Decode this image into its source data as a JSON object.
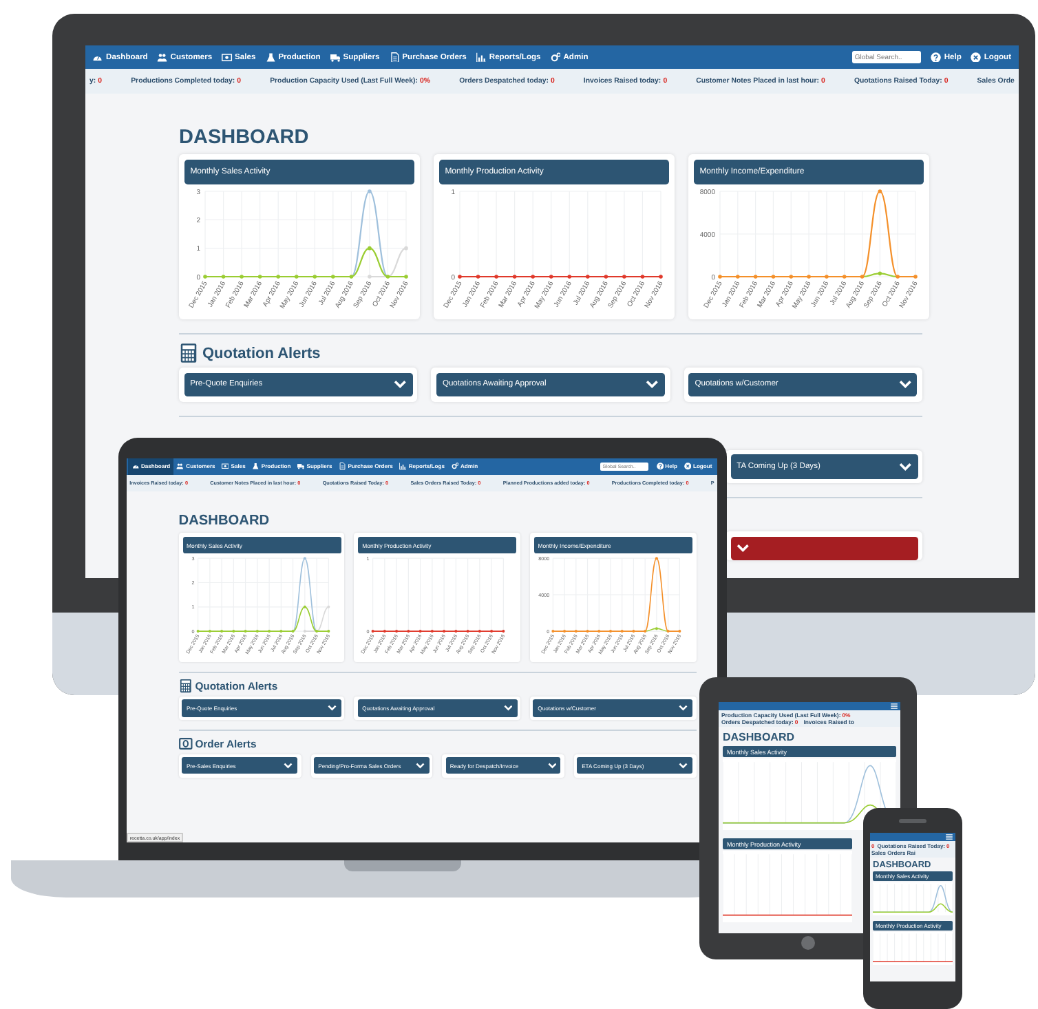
{
  "monitor": {
    "nav": {
      "items": [
        {
          "label": "Dashboard",
          "selected": false
        },
        {
          "label": "Customers",
          "selected": false
        },
        {
          "label": "Sales",
          "selected": false
        },
        {
          "label": "Production",
          "selected": false
        },
        {
          "label": "Suppliers",
          "selected": false
        },
        {
          "label": "Purchase Orders",
          "selected": false
        },
        {
          "label": "Reports/Logs",
          "selected": false
        },
        {
          "label": "Admin",
          "selected": false
        }
      ],
      "search_placeholder": "Global Search..",
      "help": "Help",
      "logout": "Logout"
    },
    "ticker": [
      {
        "label": "y:",
        "value": "0"
      },
      {
        "label": "Productions Completed today:",
        "value": "0"
      },
      {
        "label": "Production Capacity Used (Last Full Week):",
        "value": "0%"
      },
      {
        "label": "Orders Despatched today:",
        "value": "0"
      },
      {
        "label": "Invoices Raised today:",
        "value": "0"
      },
      {
        "label": "Customer Notes Placed in last hour:",
        "value": "0"
      },
      {
        "label": "Quotations Raised Today:",
        "value": "0"
      },
      {
        "label": "Sales Orde"
      }
    ],
    "title": "DASHBOARD",
    "charts": [
      {
        "chart_data": {
          "type": "line",
          "title": "Monthly Sales Activity",
          "categories": [
            "Dec 2015",
            "Jan 2016",
            "Feb 2016",
            "Mar 2016",
            "Apr 2016",
            "May 2016",
            "Jun 2016",
            "Jul 2016",
            "Aug 2016",
            "Sep 2016",
            "Oct 2016",
            "Nov 2016"
          ],
          "ylim": [
            0,
            3
          ],
          "yticks": [
            0,
            1,
            2,
            3
          ],
          "grid": true,
          "series": [
            {
              "color": "#d9d9d9",
              "values": [
                null,
                null,
                null,
                null,
                null,
                null,
                null,
                null,
                null,
                0,
                0,
                1
              ]
            },
            {
              "color": "#9fc0dc",
              "values": [
                null,
                null,
                null,
                null,
                null,
                null,
                null,
                null,
                0,
                3,
                0,
                null
              ]
            },
            {
              "color": "#9acd32",
              "values": [
                0,
                0,
                0,
                0,
                0,
                0,
                0,
                0,
                0,
                1,
                0,
                0
              ]
            }
          ]
        }
      },
      {
        "chart_data": {
          "type": "line",
          "title": "Monthly Production Activity",
          "categories": [
            "Dec 2015",
            "Jan 2016",
            "Feb 2016",
            "Mar 2016",
            "Apr 2016",
            "May 2016",
            "Jun 2016",
            "Jul 2016",
            "Aug 2016",
            "Sep 2016",
            "Oct 2016",
            "Nov 2016"
          ],
          "ylim": [
            0,
            1
          ],
          "yticks": [
            0,
            1
          ],
          "grid": true,
          "series": [
            {
              "color": "#e0392b",
              "values": [
                0,
                0,
                0,
                0,
                0,
                0,
                0,
                0,
                0,
                0,
                0,
                0
              ]
            }
          ]
        }
      },
      {
        "chart_data": {
          "type": "line",
          "title": "Monthly Income/Expenditure",
          "categories": [
            "Dec 2015",
            "Jan 2016",
            "Feb 2016",
            "Mar 2016",
            "Apr 2016",
            "May 2016",
            "Jun 2016",
            "Jul 2016",
            "Aug 2016",
            "Sep 2016",
            "Oct 2016",
            "Nov 2016"
          ],
          "ylim": [
            0,
            8000
          ],
          "yticks": [
            0,
            4000,
            8000
          ],
          "grid": true,
          "series": [
            {
              "color": "#9acd32",
              "values": [
                null,
                null,
                null,
                null,
                null,
                null,
                null,
                null,
                0,
                300,
                0,
                null
              ]
            },
            {
              "color": "#f4902a",
              "values": [
                0,
                0,
                0,
                0,
                0,
                0,
                0,
                0,
                0,
                8000,
                0,
                0
              ]
            }
          ]
        }
      }
    ],
    "sections": [
      {
        "kind": "quotation",
        "title": "Quotation Alerts",
        "dropdowns": [
          "Pre-Quote Enquiries",
          "Quotations Awaiting Approval",
          "Quotations w/Customer"
        ]
      }
    ],
    "lower_dropdowns": [
      {
        "label": "TA Coming Up (3 Days)",
        "color": "#2d5573"
      },
      {
        "color": "#a51e22"
      }
    ]
  },
  "laptop": {
    "nav": {
      "items": [
        {
          "label": "Dashboard",
          "selected": true
        },
        {
          "label": "Customers",
          "selected": false
        },
        {
          "label": "Sales",
          "selected": false
        },
        {
          "label": "Production",
          "selected": false
        },
        {
          "label": "Suppliers",
          "selected": false
        },
        {
          "label": "Purchase Orders",
          "selected": false
        },
        {
          "label": "Reports/Logs",
          "selected": false
        },
        {
          "label": "Admin",
          "selected": false
        }
      ],
      "search_placeholder": "Global Search..",
      "help": "Help",
      "logout": "Logout"
    },
    "ticker": [
      {
        "label": "Invoices Raised today:",
        "value": "0"
      },
      {
        "label": "Customer Notes Placed in last hour:",
        "value": "0"
      },
      {
        "label": "Quotations Raised Today:",
        "value": "0"
      },
      {
        "label": "Sales Orders Raised Today:",
        "value": "0"
      },
      {
        "label": "Planned Productions added today:",
        "value": "0"
      },
      {
        "label": "Productions Completed today:",
        "value": "0"
      },
      {
        "label": "P"
      }
    ],
    "title": "DASHBOARD",
    "charts": [
      {
        "chart_data": {
          "type": "line",
          "title": "Monthly Sales Activity",
          "categories": [
            "Dec 2015",
            "Jan 2016",
            "Feb 2016",
            "Mar 2016",
            "Apr 2016",
            "May 2016",
            "Jun 2016",
            "Jul 2016",
            "Aug 2016",
            "Sep 2016",
            "Oct 2016",
            "Nov 2016"
          ],
          "ylim": [
            0,
            3
          ],
          "yticks": [
            0,
            1,
            2,
            3
          ],
          "grid": true,
          "series": [
            {
              "color": "#d9d9d9",
              "values": [
                null,
                null,
                null,
                null,
                null,
                null,
                null,
                null,
                null,
                0,
                0,
                1
              ]
            },
            {
              "color": "#9fc0dc",
              "values": [
                null,
                null,
                null,
                null,
                null,
                null,
                null,
                null,
                0,
                3,
                0,
                null
              ]
            },
            {
              "color": "#9acd32",
              "values": [
                0,
                0,
                0,
                0,
                0,
                0,
                0,
                0,
                0,
                1,
                0,
                0
              ]
            }
          ]
        }
      },
      {
        "chart_data": {
          "type": "line",
          "title": "Monthly Production Activity",
          "categories": [
            "Dec 2015",
            "Jan 2016",
            "Feb 2016",
            "Mar 2016",
            "Apr 2016",
            "May 2016",
            "Jun 2016",
            "Jul 2016",
            "Aug 2016",
            "Sep 2016",
            "Oct 2016",
            "Nov 2016"
          ],
          "ylim": [
            0,
            1
          ],
          "yticks": [
            0,
            1
          ],
          "grid": true,
          "series": [
            {
              "color": "#e0392b",
              "values": [
                0,
                0,
                0,
                0,
                0,
                0,
                0,
                0,
                0,
                0,
                0,
                0
              ]
            }
          ]
        }
      },
      {
        "chart_data": {
          "type": "line",
          "title": "Monthly Income/Expenditure",
          "categories": [
            "Dec 2015",
            "Jan 2016",
            "Feb 2016",
            "Mar 2016",
            "Apr 2016",
            "May 2016",
            "Jun 2016",
            "Jul 2016",
            "Aug 2016",
            "Sep 2016",
            "Oct 2016",
            "Nov 2016"
          ],
          "ylim": [
            0,
            8000
          ],
          "yticks": [
            0,
            4000,
            8000
          ],
          "grid": true,
          "series": [
            {
              "color": "#9acd32",
              "values": [
                null,
                null,
                null,
                null,
                null,
                null,
                null,
                null,
                0,
                300,
                0,
                null
              ]
            },
            {
              "color": "#f4902a",
              "values": [
                0,
                0,
                0,
                0,
                0,
                0,
                0,
                0,
                0,
                8000,
                0,
                0
              ]
            }
          ]
        }
      }
    ],
    "sections": [
      {
        "kind": "quotation",
        "title": "Quotation Alerts",
        "dropdowns": [
          "Pre-Quote Enquiries",
          "Quotations Awaiting Approval",
          "Quotations w/Customer"
        ]
      },
      {
        "kind": "order",
        "title": "Order Alerts",
        "dropdowns": [
          "Pre-Sales Enquiries",
          "Pending/Pro-Forma Sales Orders",
          "Ready for Despatch/Invoice",
          "ETA Coming Up (3 Days)"
        ]
      }
    ],
    "status_url": "recetta.co.uk/app/index"
  },
  "tablet": {
    "ticker": [
      {
        "label": "Production Capacity Used (Last Full Week):",
        "value": "0%"
      },
      {
        "label": "Orders Despatched today:",
        "value": "0"
      },
      {
        "label": "Invoices Raised to"
      }
    ],
    "title": "DASHBOARD",
    "panels": [
      {
        "title": "Monthly Sales Activity",
        "kind": "sales"
      },
      {
        "title": "Monthly Production Activity",
        "kind": "production"
      }
    ]
  },
  "phone": {
    "ticker": [
      {
        "value": "0"
      },
      {
        "label": "Quotations Raised Today:",
        "value": "0"
      },
      {
        "label": "Sales Orders Rai"
      }
    ],
    "title": "DASHBOARD",
    "panels": [
      {
        "title": "Monthly Sales Activity",
        "kind": "sales"
      },
      {
        "title": "Monthly Production Activity",
        "kind": "production"
      }
    ]
  }
}
